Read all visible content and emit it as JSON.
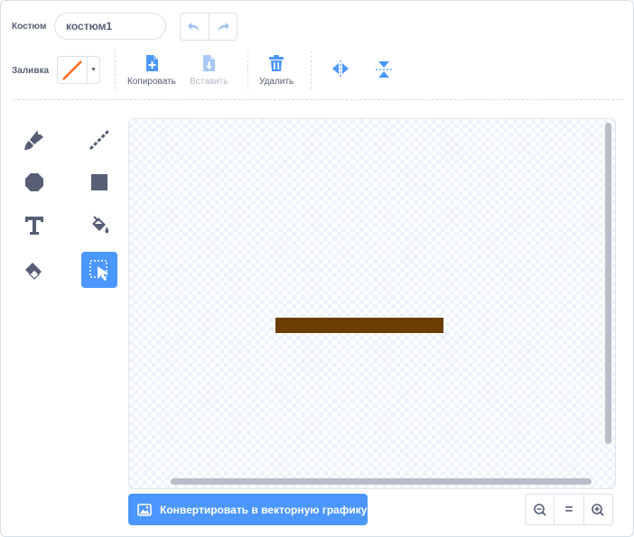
{
  "costume": {
    "label": "Костюм",
    "name_value": "костюм1",
    "fill_label": "Заливка"
  },
  "toolbar": {
    "copy_label": "Копировать",
    "paste_label": "Вставить",
    "delete_label": "Удалить"
  },
  "convert": {
    "label": "Конвертировать в векторную графику"
  },
  "zoom": {
    "reset_label": "="
  },
  "colors": {
    "accent": "#4c97ff",
    "shape": "#6a3d00",
    "fill_line": "#ff661a",
    "text": "#575e75"
  },
  "icons": {
    "undo": "undo-icon",
    "redo": "redo-icon",
    "copy": "copy-icon",
    "paste": "paste-icon",
    "delete": "trash-icon",
    "flip_h": "flip-horizontal-icon",
    "flip_v": "flip-vertical-icon",
    "brush": "brush-icon",
    "line": "line-icon",
    "circle": "circle-icon",
    "rect": "rectangle-icon",
    "text": "text-icon",
    "fill": "fill-bucket-icon",
    "eraser": "eraser-icon",
    "select": "select-icon",
    "image": "image-icon",
    "zoom_out": "zoom-out-icon",
    "zoom_in": "zoom-in-icon"
  }
}
